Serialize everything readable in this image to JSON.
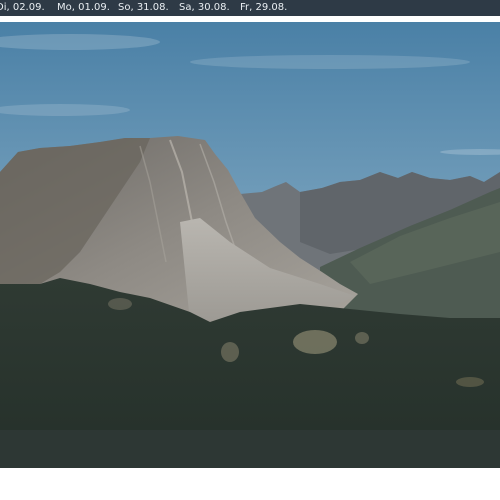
{
  "date_nav": {
    "days": [
      {
        "label": "Di, 02.09."
      },
      {
        "label": "Mo, 01.09."
      },
      {
        "label": "So, 31.08."
      },
      {
        "label": "Sa, 30.08."
      },
      {
        "label": "Fr, 29.08."
      }
    ]
  },
  "colors": {
    "nav_bg": "#2e3a46",
    "nav_text": "#e9eef2",
    "sky_top": "#4f86aa",
    "sky_bottom": "#9fbfd3",
    "forest": "#27332d",
    "rock": "#8c8881"
  }
}
